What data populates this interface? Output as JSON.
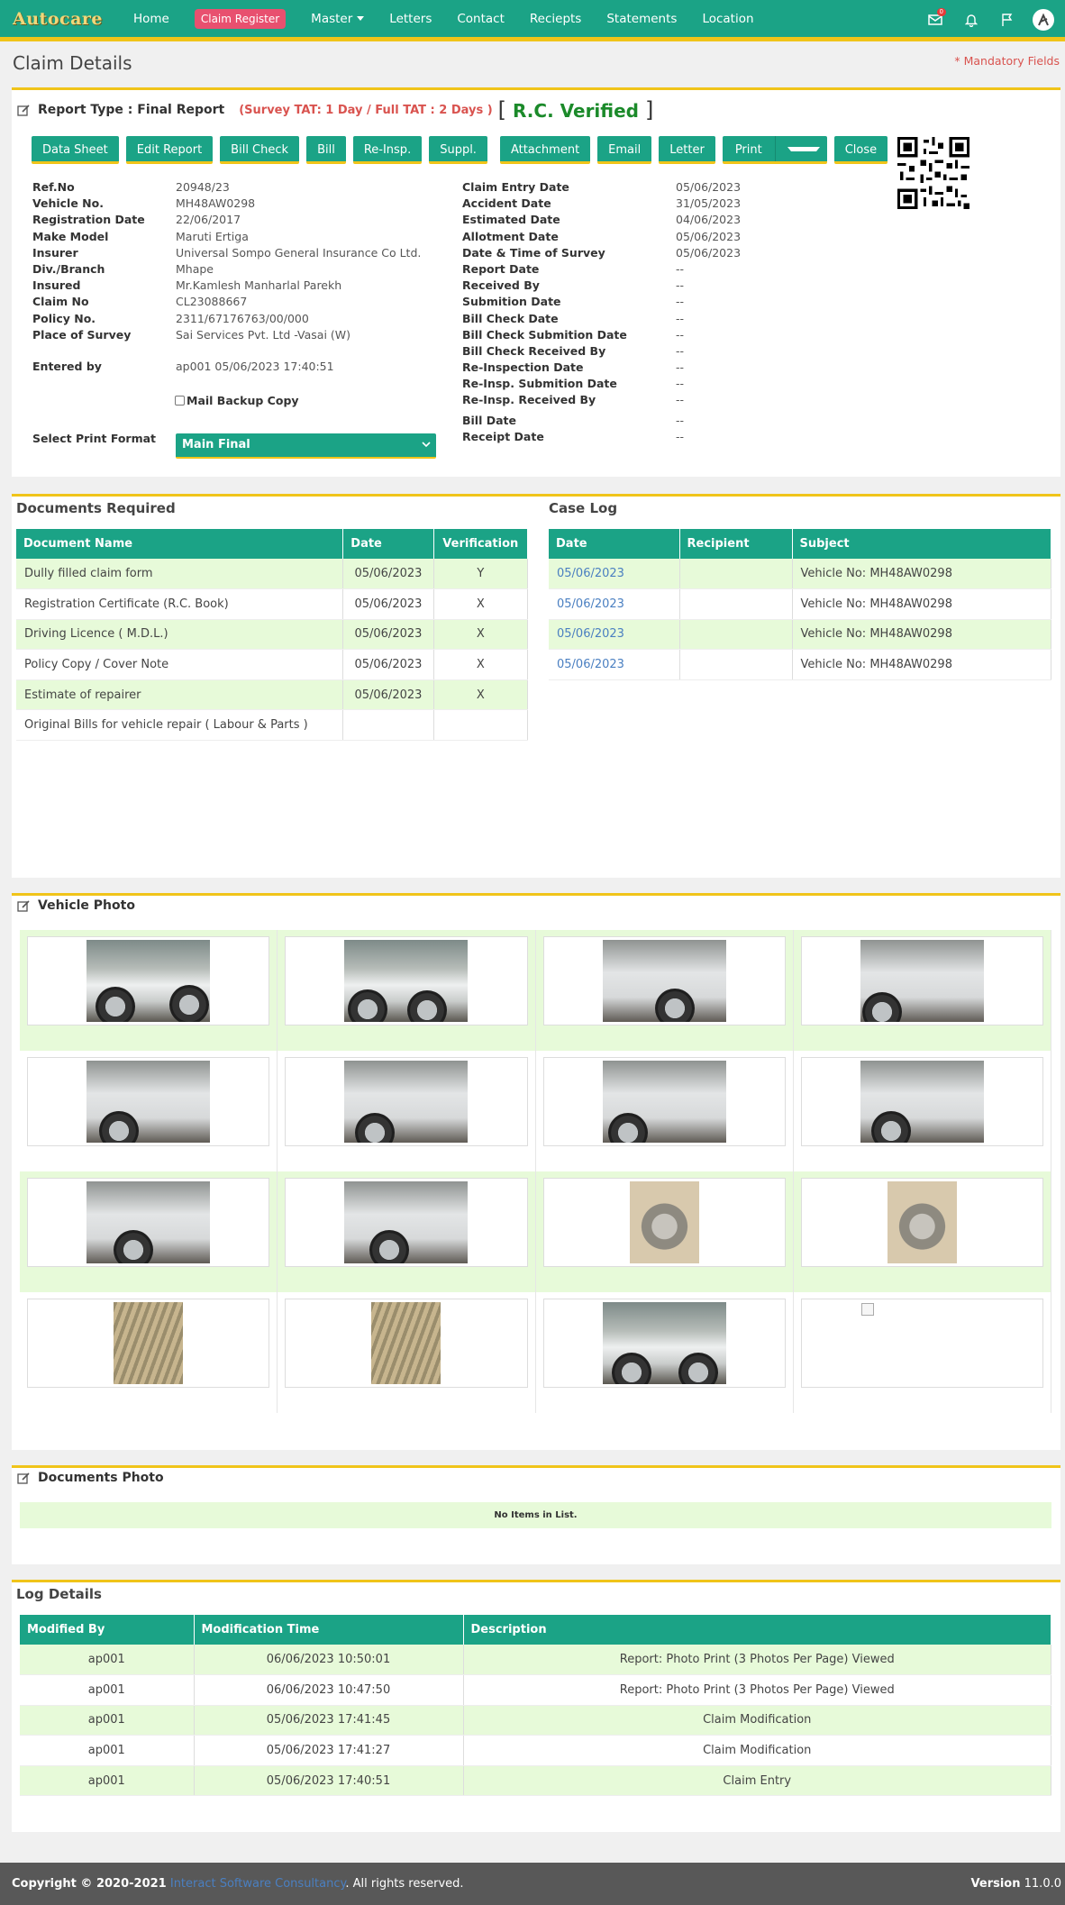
{
  "nav": {
    "brand": "Autocare",
    "items": [
      "Home",
      "Claim Register",
      "Master",
      "Letters",
      "Contact",
      "Reciepts",
      "Statements",
      "Location"
    ],
    "mail_badge": "0"
  },
  "page": {
    "title": "Claim Details",
    "mandatory": "* Mandatory Fields"
  },
  "report": {
    "type": "Report Type : Final Report",
    "tat": "(Survey TAT: 1 Day / Full TAT : 2 Days )",
    "rc_open": "[",
    "rc_text": "R.C. Verified",
    "rc_close": "]"
  },
  "buttons": [
    "Data Sheet",
    "Edit Report",
    "Bill Check",
    "Bill",
    "Re-Insp.",
    "Suppl.",
    "Attachment",
    "Email",
    "Letter",
    "Print",
    "Close"
  ],
  "left_info": [
    {
      "label": "Ref.No",
      "value": "20948/23"
    },
    {
      "label": "Vehicle No.",
      "value": "MH48AW0298"
    },
    {
      "label": "Registration Date",
      "value": "22/06/2017"
    },
    {
      "label": "Make Model",
      "value": "Maruti Ertiga"
    },
    {
      "label": "Insurer",
      "value": "Universal Sompo General Insurance Co Ltd."
    },
    {
      "label": "Div./Branch",
      "value": "Mhape"
    },
    {
      "label": "Insured",
      "value": "Mr.Kamlesh Manharlal Parekh"
    },
    {
      "label": "Claim No",
      "value": "CL23088667"
    },
    {
      "label": "Policy No.",
      "value": "2311/67176763/00/000"
    },
    {
      "label": "Place of Survey",
      "value": "Sai Services Pvt. Ltd -Vasai (W)"
    }
  ],
  "entered_by": {
    "label": "Entered by",
    "value": "ap001 05/06/2023 17:40:51"
  },
  "mail_backup": "Mail Backup Copy",
  "print_format": {
    "label": "Select Print Format",
    "selected": "Main Final"
  },
  "right_info": [
    {
      "label": "Claim Entry Date",
      "value": "05/06/2023"
    },
    {
      "label": "Accident Date",
      "value": "31/05/2023"
    },
    {
      "label": "Estimated Date",
      "value": "04/06/2023"
    },
    {
      "label": "Allotment Date",
      "value": "05/06/2023"
    },
    {
      "label": "Date & Time of Survey",
      "value": "05/06/2023"
    },
    {
      "label": "Report Date",
      "value": "--"
    },
    {
      "label": "Received By",
      "value": "--"
    },
    {
      "label": "Submition Date",
      "value": "--"
    },
    {
      "label": "Bill Check Date",
      "value": "--"
    },
    {
      "label": "Bill Check Submition Date",
      "value": "--"
    },
    {
      "label": "Bill Check Received By",
      "value": "--"
    },
    {
      "label": "Re-Inspection Date",
      "value": "--"
    },
    {
      "label": "Re-Insp. Submition Date",
      "value": "--"
    },
    {
      "label": "Re-Insp. Received By",
      "value": "--"
    }
  ],
  "right_info2": [
    {
      "label": "Bill Date",
      "value": "--"
    },
    {
      "label": "Receipt Date",
      "value": "--"
    }
  ],
  "documents": {
    "title": "Documents Required",
    "headers": [
      "Document Name",
      "Date",
      "Verification"
    ],
    "rows": [
      [
        "Dully filled claim form",
        "05/06/2023",
        "Y"
      ],
      [
        "Registration Certificate (R.C. Book)",
        "05/06/2023",
        "X"
      ],
      [
        "Driving Licence ( M.D.L.)",
        "05/06/2023",
        "X"
      ],
      [
        "Policy Copy / Cover Note",
        "05/06/2023",
        "X"
      ],
      [
        "Estimate of repairer",
        "05/06/2023",
        "X"
      ],
      [
        "Original Bills for vehicle repair ( Labour & Parts )",
        "",
        ""
      ]
    ]
  },
  "case_log": {
    "title": "Case Log",
    "headers": [
      "Date",
      "Recipient",
      "Subject"
    ],
    "rows": [
      [
        "05/06/2023",
        "",
        "Vehicle No: MH48AW0298"
      ],
      [
        "05/06/2023",
        "",
        "Vehicle No: MH48AW0298"
      ],
      [
        "05/06/2023",
        "",
        "Vehicle No: MH48AW0298"
      ],
      [
        "05/06/2023",
        "",
        "Vehicle No: MH48AW0298"
      ]
    ]
  },
  "vehicle_photo": {
    "title": "Vehicle Photo"
  },
  "documents_photo": {
    "title": "Documents Photo",
    "empty": "No Items in List."
  },
  "log_details": {
    "title": "Log Details",
    "headers": [
      "Modified By",
      "Modification Time",
      "Description"
    ],
    "rows": [
      [
        "ap001",
        "06/06/2023 10:50:01",
        "Report: Photo Print (3 Photos Per Page) Viewed"
      ],
      [
        "ap001",
        "06/06/2023 10:47:50",
        "Report: Photo Print (3 Photos Per Page) Viewed"
      ],
      [
        "ap001",
        "05/06/2023 17:41:45",
        "Claim Modification"
      ],
      [
        "ap001",
        "05/06/2023 17:41:27",
        "Claim Modification"
      ],
      [
        "ap001",
        "05/06/2023 17:40:51",
        "Claim Entry"
      ]
    ]
  },
  "footer": {
    "copyright": "Copyright © 2020-2021",
    "company": "Interact Software Consultancy",
    "rights": ". All rights reserved.",
    "version_label": "Version",
    "version": "11.0.0"
  },
  "colors": {
    "primary": "#1ba386",
    "accent": "#f0c419",
    "row_alt": "#e7fad9",
    "danger": "#d9534f",
    "verified": "#1b8a2a"
  },
  "icons": [
    "mail-icon",
    "bell-icon",
    "flag-icon",
    "user-avatar-icon",
    "edit-icon",
    "qr-code",
    "chevron-down-icon"
  ]
}
